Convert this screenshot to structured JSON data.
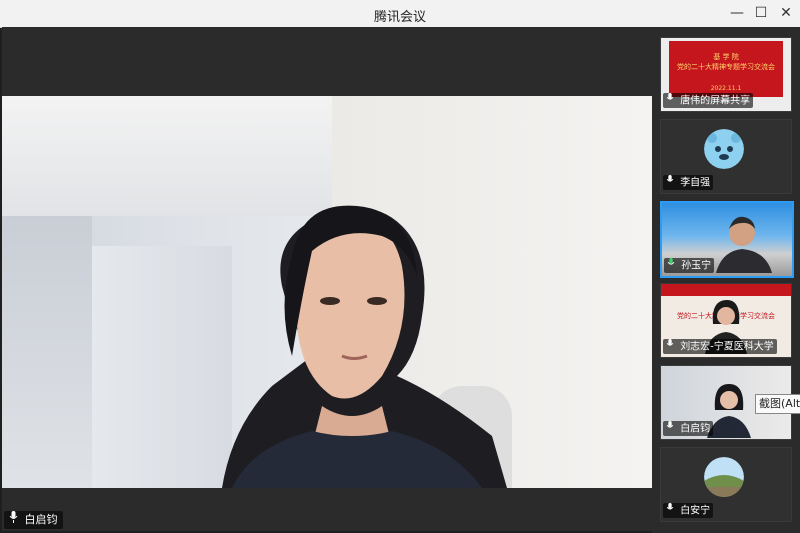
{
  "window": {
    "title": "腾讯会议",
    "controls": {
      "minimize": "—",
      "maximize": "☐",
      "close": "✕"
    }
  },
  "main_video": {
    "participant_name": "白启钧",
    "mic_icon": "mic-icon"
  },
  "participants": [
    {
      "name": "唐伟的屏幕共享",
      "type": "screen-share",
      "share_lines": [
        "基 学 院",
        "党的二十大精神专题学习交流会",
        "2022.11.1"
      ]
    },
    {
      "name": "李自强",
      "type": "avatar"
    },
    {
      "name": "孙玉宁",
      "type": "video",
      "active": true
    },
    {
      "name": "刘志宏-宁夏医科大学",
      "type": "video",
      "banner": "党的二十大精神专题学习交流会"
    },
    {
      "name": "白启钧",
      "type": "video"
    },
    {
      "name": "白安宁",
      "type": "avatar"
    }
  ],
  "tooltip": "截图(Alt",
  "colors": {
    "titlebar_bg": "#f2f2f2",
    "window_bg": "#2b2b2b",
    "active_border": "#2c9cf5",
    "share_red": "#c4161c",
    "share_text": "#ffd36a"
  }
}
